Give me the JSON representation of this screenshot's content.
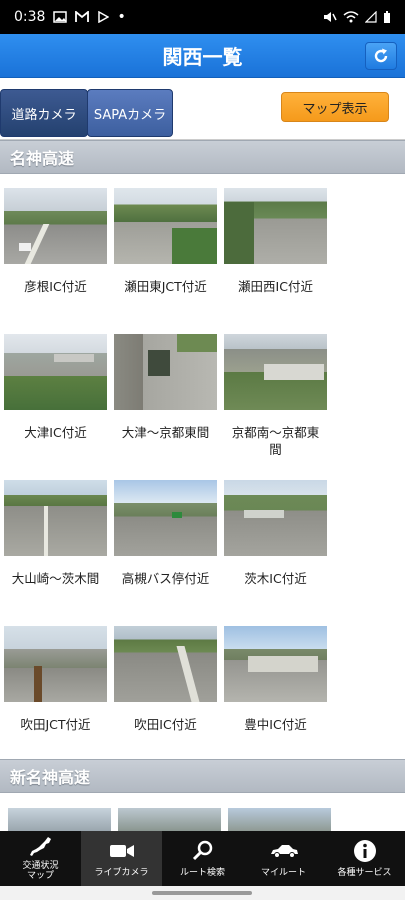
{
  "status_bar": {
    "time": "0:38",
    "dot": "•"
  },
  "header": {
    "title": "関西一覧"
  },
  "tabs": [
    {
      "label": "道路カメラ"
    },
    {
      "label": "SAPAカメラ"
    }
  ],
  "map_button": {
    "label": "マップ表示"
  },
  "sections": [
    {
      "title": "名神高速",
      "cameras": [
        {
          "label": "彦根IC付近"
        },
        {
          "label": "瀬田東JCT付近"
        },
        {
          "label": "瀬田西IC付近"
        },
        {
          "label": "大津IC付近"
        },
        {
          "label": "大津～京都東間"
        },
        {
          "label": "京都南～京都東\n間"
        },
        {
          "label": "大山崎～茨木間"
        },
        {
          "label": "高槻バス停付近"
        },
        {
          "label": "茨木IC付近"
        },
        {
          "label": "吹田JCT付近"
        },
        {
          "label": "吹田IC付近"
        },
        {
          "label": "豊中IC付近"
        }
      ]
    },
    {
      "title": "新名神高速"
    }
  ],
  "bottom_nav": [
    {
      "label": "交通状況\nマップ",
      "icon": "japan-map-icon"
    },
    {
      "label": "ライブカメラ",
      "icon": "video-camera-icon"
    },
    {
      "label": "ルート検索",
      "icon": "magnifier-icon"
    },
    {
      "label": "マイルート",
      "icon": "car-icon"
    },
    {
      "label": "各種サービス",
      "icon": "info-icon"
    }
  ]
}
